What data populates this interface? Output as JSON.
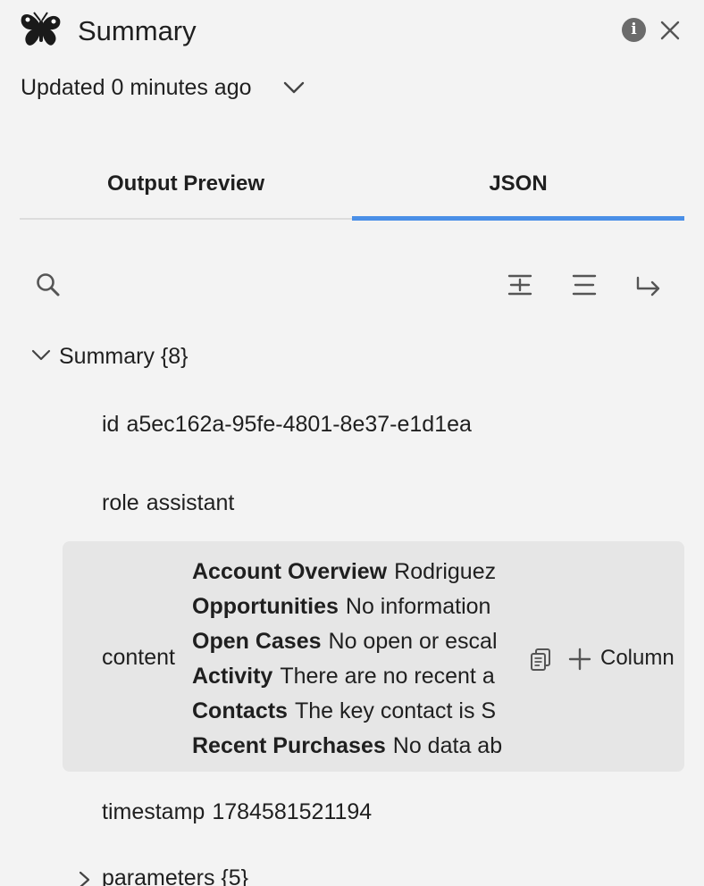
{
  "header": {
    "title": "Summary",
    "updated": "Updated 0 minutes ago",
    "icons": {
      "logo": "butterfly-icon",
      "info": "info-icon",
      "close": "close-icon",
      "dropdown": "chevron-down-icon"
    }
  },
  "tabs": [
    {
      "label": "Output Preview",
      "active": false
    },
    {
      "label": "JSON",
      "active": true
    }
  ],
  "toolbar": {
    "icons": [
      "search-icon",
      "expand-all-icon",
      "collapse-all-icon",
      "wrap-icon"
    ]
  },
  "tree": {
    "root": {
      "key": "Summary",
      "count": "{8}",
      "expanded": true
    },
    "id": {
      "key": "id",
      "value": "a5ec162a-95fe-4801-8e37-e1d1ea"
    },
    "role": {
      "key": "role",
      "value": "assistant"
    },
    "content": {
      "key": "content",
      "lines": [
        {
          "heading": "Account Overview",
          "text": "Rodriguez"
        },
        {
          "heading": "Opportunities",
          "text": "No information"
        },
        {
          "heading": "Open Cases",
          "text": "No open or escal"
        },
        {
          "heading": "Activity",
          "text": "There are no recent a"
        },
        {
          "heading": "Contacts",
          "text": "The key contact is S"
        },
        {
          "heading": "Recent Purchases",
          "text": "No data ab"
        }
      ],
      "add_column_label": "Column"
    },
    "timestamp": {
      "key": "timestamp",
      "value": "1784581521194"
    },
    "parameters": {
      "key": "parameters",
      "count": "{5}",
      "expanded": false
    }
  },
  "colors": {
    "accent": "#4a8fe7",
    "background": "#f3f3f3",
    "highlight": "#e6e6e6"
  }
}
